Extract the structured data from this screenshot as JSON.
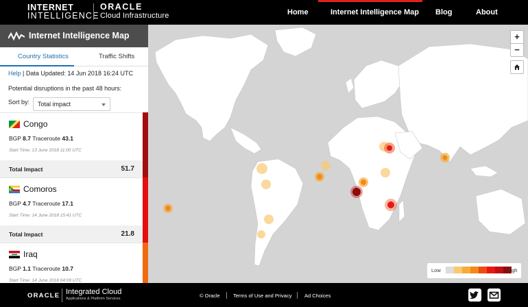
{
  "header": {
    "logo_line1": "INTERNET",
    "logo_line2": "INTELLIGENCE",
    "oracle_line1": "ORACLE",
    "oracle_line2": "Cloud Infrastructure",
    "nav": [
      "Home",
      "Internet Intelligence Map",
      "Blog",
      "About"
    ],
    "active_nav": "Internet Intelligence Map"
  },
  "sidebar": {
    "title": "Internet Intelligence Map",
    "tabs": [
      "Country Statistics",
      "Traffic Shifts"
    ],
    "active_tab": "Country Statistics",
    "help_link": "Help",
    "data_updated": "| Data Updated: 14 Jun 2018 16:24 UTC",
    "disruptions_text": "Potential disruptions in the past 48 hours:",
    "sort_label": "Sort by:",
    "sort_value": "Total impact",
    "total_label": "Total Impact",
    "countries": [
      {
        "name": "Congo",
        "bgp_label": "BGP",
        "bgp": "8.7",
        "tr_label": "Traceroute",
        "traceroute": "43.1",
        "start": "Start Time: 13 June 2018 11:00 UTC",
        "total": "51.7",
        "color": "#a30d0d"
      },
      {
        "name": "Comoros",
        "bgp_label": "BGP",
        "bgp": "4.7",
        "tr_label": "Traceroute",
        "traceroute": "17.1",
        "start": "Start Time: 14 June 2018 15:41 UTC",
        "total": "21.8",
        "color": "#e50e0e"
      },
      {
        "name": "Iraq",
        "bgp_label": "BGP",
        "bgp": "1.1",
        "tr_label": "Traceroute",
        "traceroute": "10.7",
        "start": "Start Time: 14 June 2018 04:09 UTC",
        "total": "",
        "color": "#f26a10"
      }
    ]
  },
  "map": {
    "zoom_in": "+",
    "zoom_out": "−",
    "home_icon": "home-icon",
    "legend_low": "Low",
    "legend_high": "High",
    "legend_colors": [
      "#dcdcdc",
      "#f9c870",
      "#f7ab3a",
      "#f28a17",
      "#f04a10",
      "#e51818",
      "#c11010",
      "#8f0a0a"
    ]
  },
  "footer": {
    "oracle": "ORACLE",
    "brand": "Integrated Cloud",
    "brand_sub": "Applications & Platform Services",
    "links": [
      "© Oracle",
      "Terms of Use and Privacy",
      "Ad Choices"
    ],
    "social": [
      "twitter-icon",
      "mail-icon"
    ]
  }
}
